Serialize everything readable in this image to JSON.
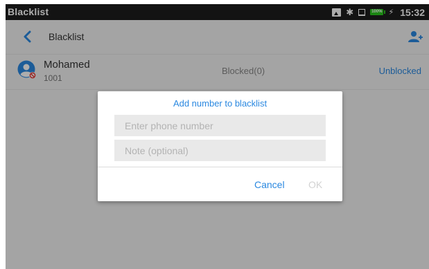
{
  "status_bar": {
    "app_title": "Blacklist",
    "icons": [
      "image-icon",
      "bluetooth-icon",
      "network-icon",
      "battery-icon",
      "charging-icon"
    ],
    "battery_level": "100%",
    "time": "15:32"
  },
  "header": {
    "title": "Blacklist"
  },
  "list": {
    "entries": [
      {
        "name": "Mohamed",
        "number": "1001",
        "status": "Blocked(0)",
        "action": "Unblocked"
      }
    ]
  },
  "dialog": {
    "title": "Add number to blacklist",
    "phone_placeholder": "Enter phone number",
    "note_placeholder": "Note (optional)",
    "cancel_label": "Cancel",
    "ok_label": "OK"
  },
  "colors": {
    "accent": "#2a88e0",
    "status_bar": "#1d1d1d",
    "battery": "#28c41b",
    "disabled": "#d2d2d2"
  }
}
